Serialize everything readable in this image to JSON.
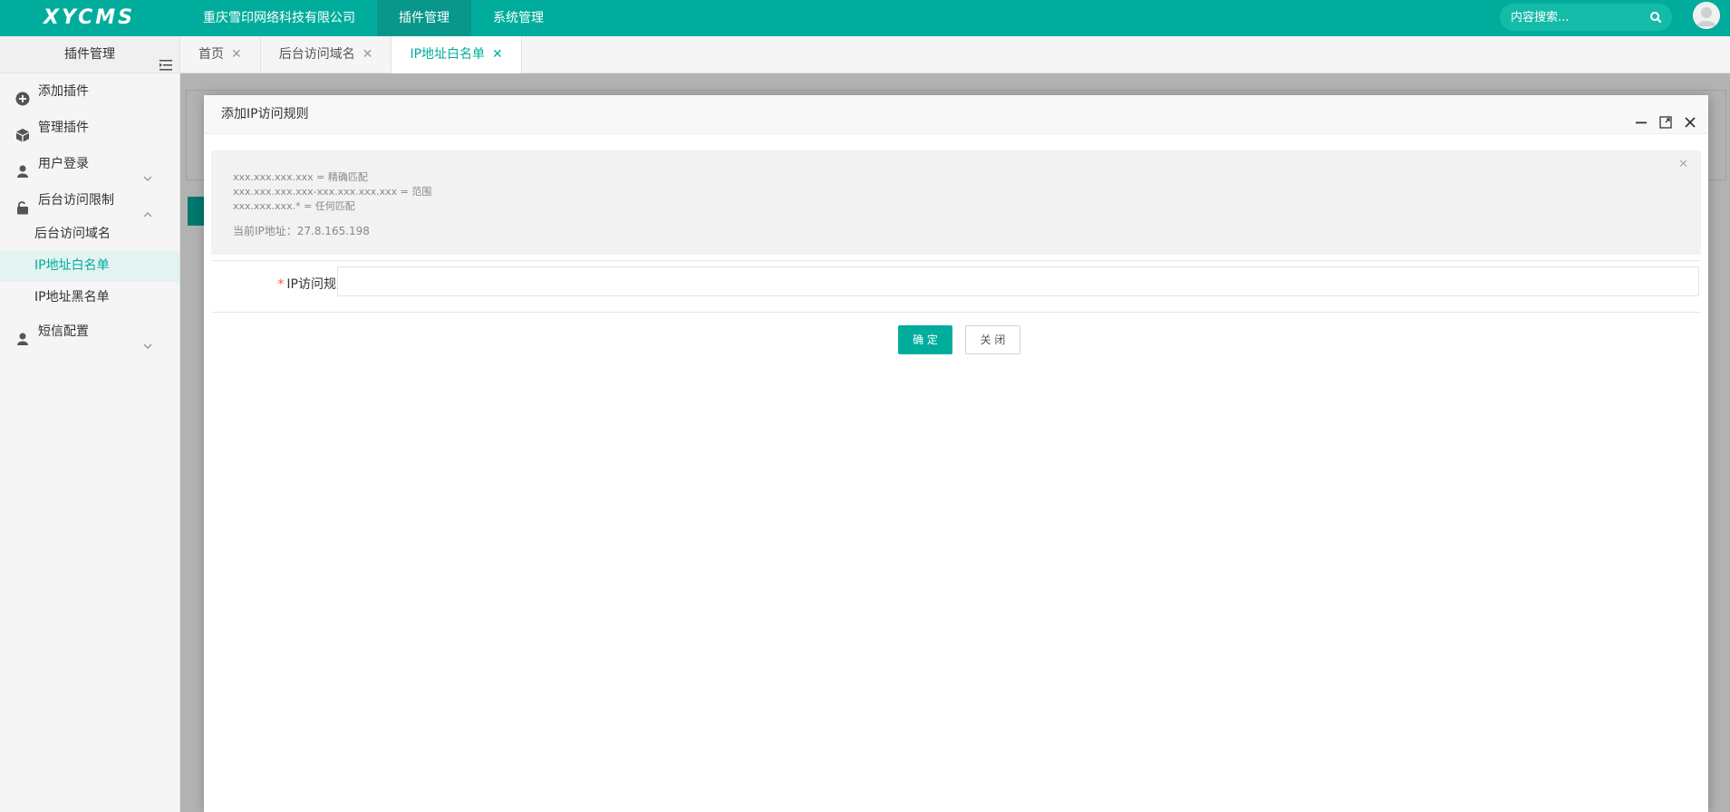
{
  "header": {
    "logo": "XYCMS",
    "nav": [
      "重庆雪印网络科技有限公司",
      "插件管理",
      "系统管理"
    ],
    "active_nav": "插件管理",
    "search_placeholder": "内容搜索..."
  },
  "sidebar": {
    "title": "插件管理",
    "items": [
      {
        "label": "添加插件",
        "icon": "plus-circle-icon"
      },
      {
        "label": "管理插件",
        "icon": "cube-icon"
      },
      {
        "label": "用户登录",
        "icon": "user-icon",
        "expandable": true,
        "expanded": false
      },
      {
        "label": "后台访问限制",
        "icon": "unlock-icon",
        "expandable": true,
        "expanded": true
      },
      {
        "label": "短信配置",
        "icon": "user-icon",
        "expandable": true,
        "expanded": false
      }
    ],
    "sub_items": [
      "后台访问域名",
      "IP地址白名单",
      "IP地址黑名单"
    ],
    "active_sub": "IP地址白名单"
  },
  "tabs": [
    {
      "label": "首页",
      "active": false
    },
    {
      "label": "后台访问域名",
      "active": false
    },
    {
      "label": "IP地址白名单",
      "active": true
    }
  ],
  "dialog": {
    "title": "添加IP访问规则",
    "notice": {
      "lines": [
        "xxx.xxx.xxx.xxx = 精确匹配",
        "xxx.xxx.xxx.xxx-xxx.xxx.xxx.xxx = 范围",
        "xxx.xxx.xxx.* = 任何匹配"
      ],
      "current_ip": "当前IP地址：27.8.165.198"
    },
    "field_label": "IP访问规则",
    "field_value": "",
    "confirm_label": "确 定",
    "close_label": "关 闭"
  },
  "colors": {
    "primary": "#00ad9c",
    "primary_dark": "#08978a",
    "required": "#ff5722"
  }
}
